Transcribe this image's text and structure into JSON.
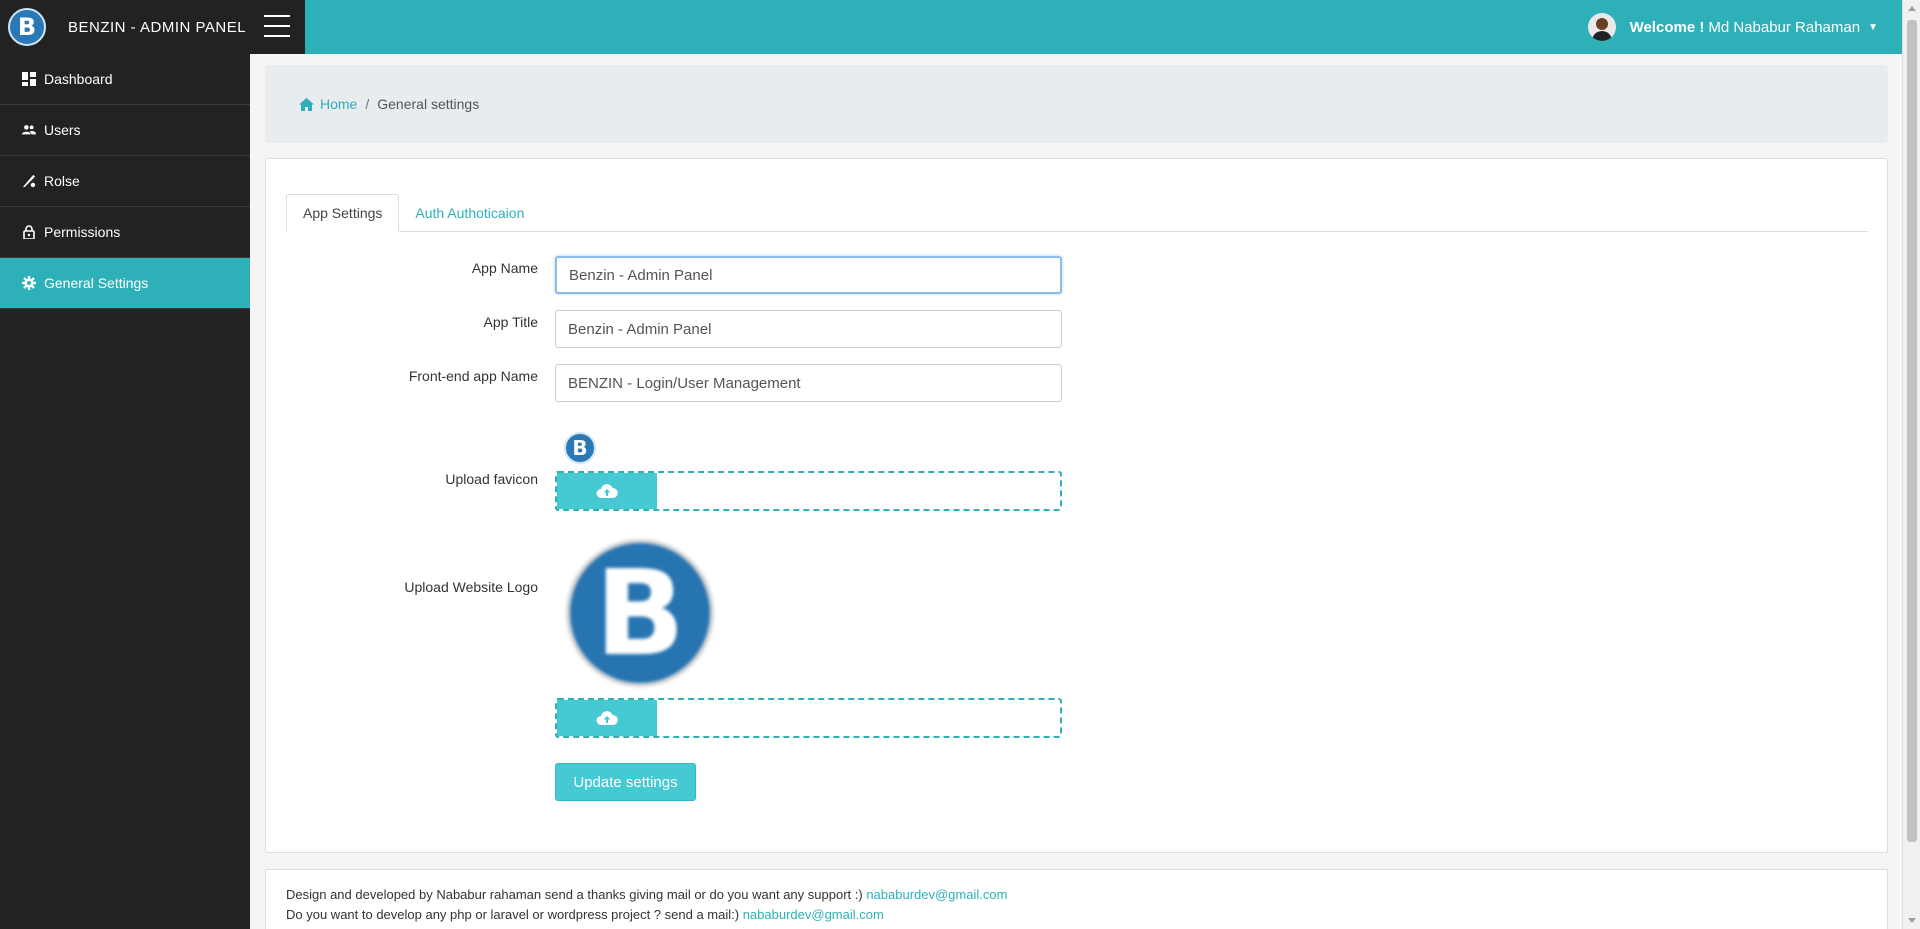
{
  "brand": {
    "logo_letter": "B",
    "name": "BENZIN - ADMIN PANEL"
  },
  "user": {
    "welcome_bold": "Welcome !",
    "name": "Md Nababur Rahaman"
  },
  "sidebar": {
    "items": [
      {
        "label": "Dashboard",
        "icon": "dashboard-icon"
      },
      {
        "label": "Users",
        "icon": "users-icon"
      },
      {
        "label": "Rolse",
        "icon": "roles-icon"
      },
      {
        "label": "Permissions",
        "icon": "lock-icon"
      },
      {
        "label": "General Settings",
        "icon": "gear-icon",
        "active": true
      }
    ]
  },
  "breadcrumb": {
    "home": "Home",
    "separator": "/",
    "current": "General settings"
  },
  "tabs": [
    {
      "label": "App Settings",
      "active": true
    },
    {
      "label": "Auth Authoticaion",
      "active": false
    }
  ],
  "form": {
    "app_name_label": "App Name",
    "app_name_value": "Benzin - Admin Panel",
    "app_title_label": "App Title",
    "app_title_value": "Benzin - Admin Panel",
    "frontend_name_label": "Front-end app Name",
    "frontend_name_value": "BENZIN - Login/User Management",
    "favicon_label": "Upload favicon",
    "favicon_letter": "B",
    "logo_label": "Upload Website Logo",
    "logo_letter": "B",
    "submit_label": "Update settings"
  },
  "footer": {
    "line1_text": "Design and developed by Nababur rahaman send a thanks giving mail or do you want any support :)",
    "line1_email": "nababurdev@gmail.com",
    "line2_text": "Do you want to develop any php or laravel or wordpress project ? send a mail:)",
    "line2_email": "nababurdev@gmail.com"
  },
  "colors": {
    "accent": "#2eb0b9",
    "sidebar_bg": "#222222",
    "button": "#45c9d3"
  }
}
